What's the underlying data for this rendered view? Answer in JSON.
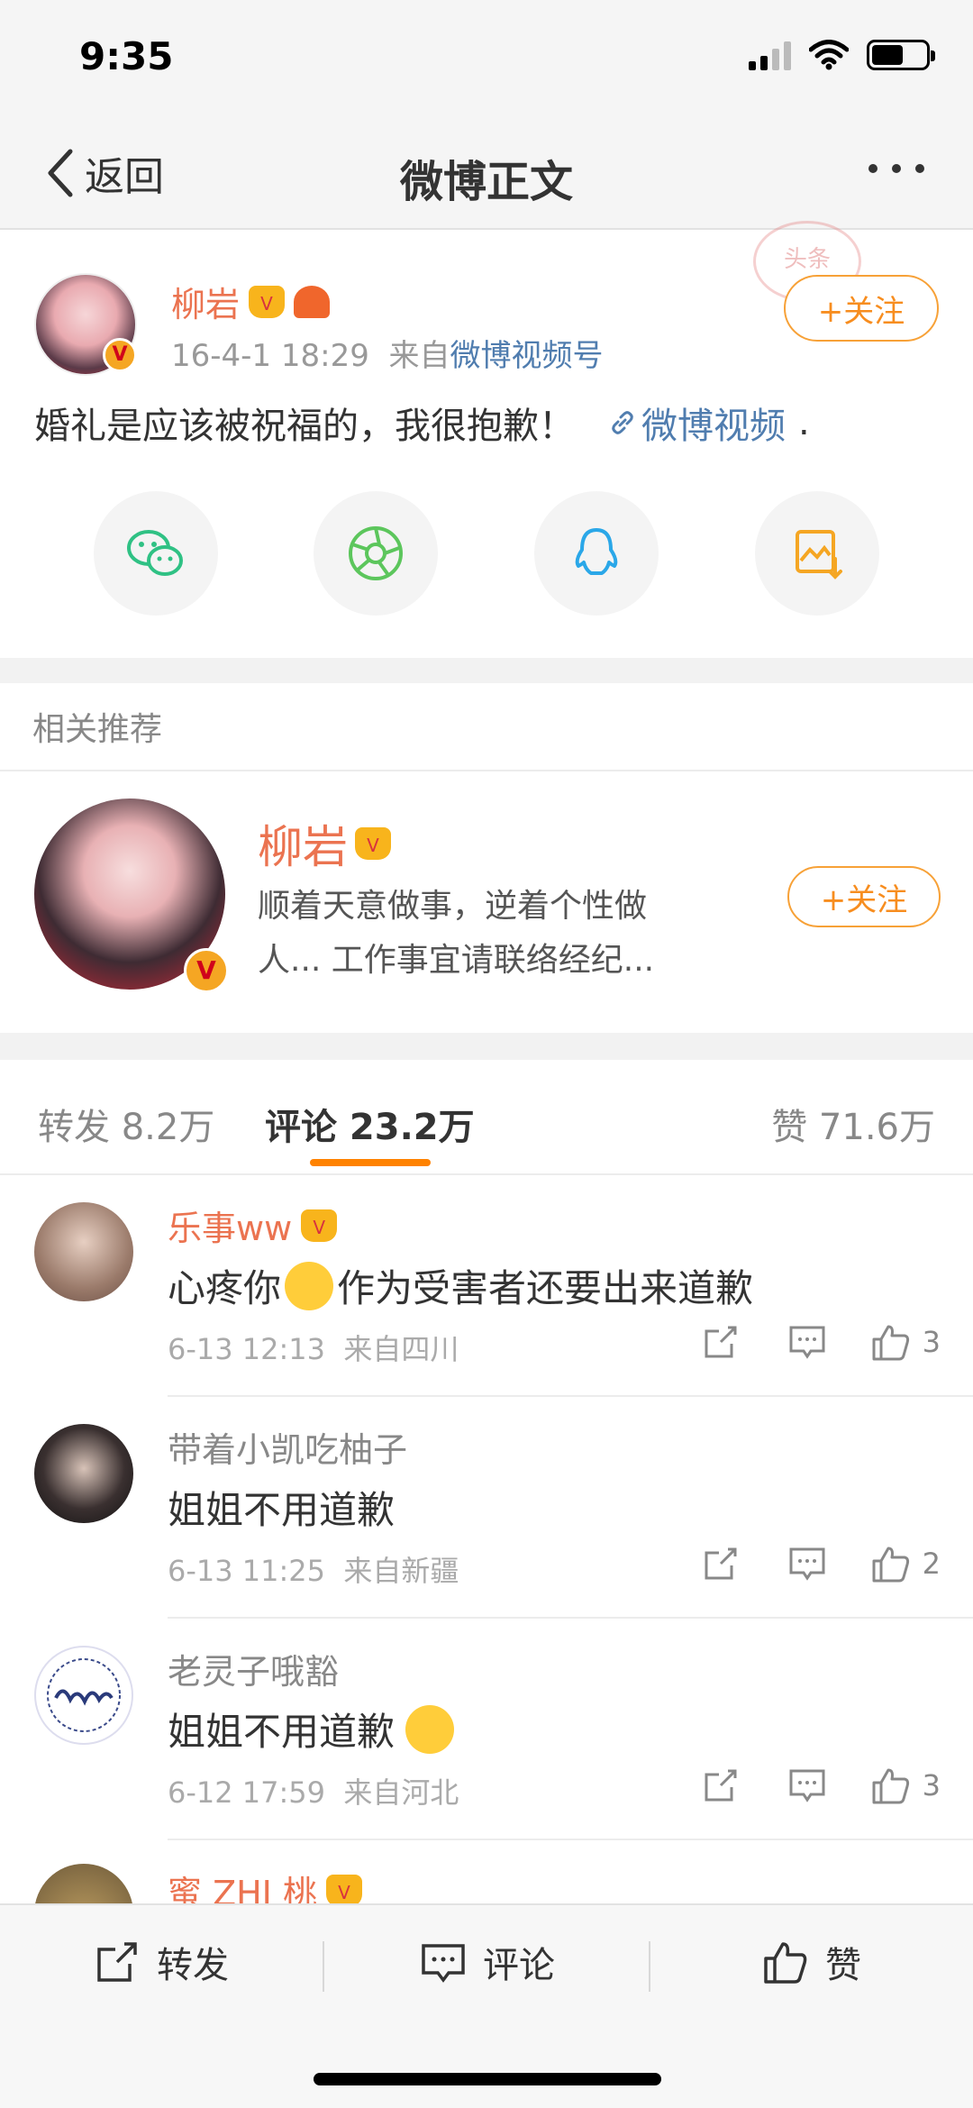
{
  "status_bar": {
    "time": "9:35"
  },
  "nav": {
    "back_label": "返回",
    "title": "微博正文"
  },
  "post": {
    "stamp_text": "头条",
    "author": "柳岩",
    "time": "16-4-1 18:29",
    "source_prefix": "来自",
    "source": "微博视频号",
    "follow_label": "+关注",
    "text": "婚礼是应该被祝福的，我很抱歉！",
    "link_label": "微博视频",
    "trailing": ".",
    "share_icons": [
      "wechat-icon",
      "moments-icon",
      "qq-icon",
      "save-image-icon"
    ]
  },
  "recommend": {
    "header": "相关推荐",
    "name": "柳岩",
    "desc": "顺着天意做事，逆着个性做人... 工作事宜请联络经纪...",
    "follow_label": "+关注"
  },
  "tabs": {
    "repost": "转发 8.2万",
    "comments": "评论 23.2万",
    "likes": "赞 71.6万",
    "active": "comments"
  },
  "comments": [
    {
      "user": "乐事ww",
      "vip": true,
      "text": "心疼你",
      "emoji": "pleading-face-emoji",
      "text_after": "作为受害者还要出来道歉",
      "time": "6-13 12:13",
      "location": "来自四川",
      "likes": "3"
    },
    {
      "user": "带着小凯吃柚子",
      "vip": false,
      "text": "姐姐不用道歉",
      "emoji": "",
      "text_after": "",
      "time": "6-13 11:25",
      "location": "来自新疆",
      "likes": "2"
    },
    {
      "user": "老灵子哦豁",
      "vip": false,
      "text": "姐姐不用道歉",
      "emoji": "hugging-heart-emoji",
      "text_after": "",
      "time": "6-12 17:59",
      "location": "来自河北",
      "likes": "3"
    },
    {
      "user": "蜜 ZHI 桃",
      "vip": true
    }
  ],
  "toolbar": {
    "repost": "转发",
    "comment": "评论",
    "like": "赞"
  },
  "colors": {
    "accent": "#ff8200",
    "name_orange": "#eb7350",
    "link_blue": "#507daf",
    "follow_orange": "#f78d1f"
  }
}
